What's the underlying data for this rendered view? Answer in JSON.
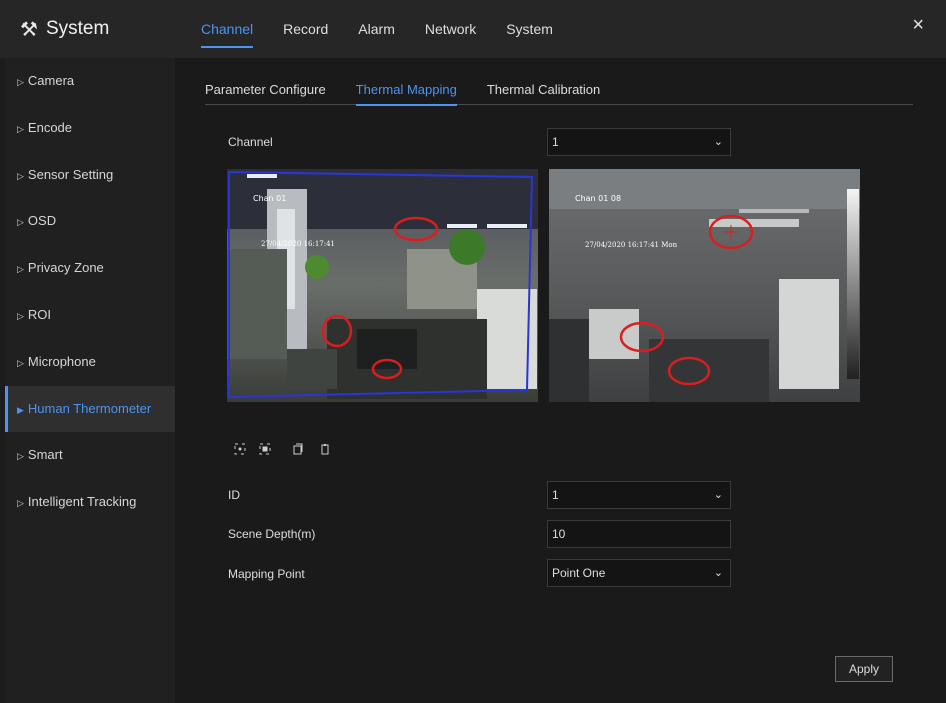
{
  "app": {
    "title": "System"
  },
  "tabs": [
    "Channel",
    "Record",
    "Alarm",
    "Network",
    "System"
  ],
  "close_label": "×",
  "sidebar": [
    "Camera",
    "Encode",
    "Sensor Setting",
    "OSD",
    "Privacy Zone",
    "ROI",
    "Microphone",
    "Human Thermometer",
    "Smart",
    "Intelligent Tracking"
  ],
  "subtabs": [
    "Parameter Configure",
    "Thermal Mapping",
    "Thermal Calibration"
  ],
  "form": {
    "channel_label": "Channel",
    "channel_value": "1",
    "id_label": "ID",
    "id_value": "1",
    "depth_label": "Scene Depth(m)",
    "depth_value": "10",
    "mapping_label": "Mapping Point",
    "mapping_value": "Point One"
  },
  "video": {
    "left_osd_channel": "Chan 01",
    "left_osd_time": "27/04/2020 16:17:41",
    "right_osd_channel": "Chan 01 08",
    "right_osd_time": "27/04/2020 16:17:41 Mon"
  },
  "apply_label": "Apply",
  "colors": {
    "accent": "#4c93f2",
    "marker": "#d81e1e",
    "roi": "#2a35d8"
  }
}
